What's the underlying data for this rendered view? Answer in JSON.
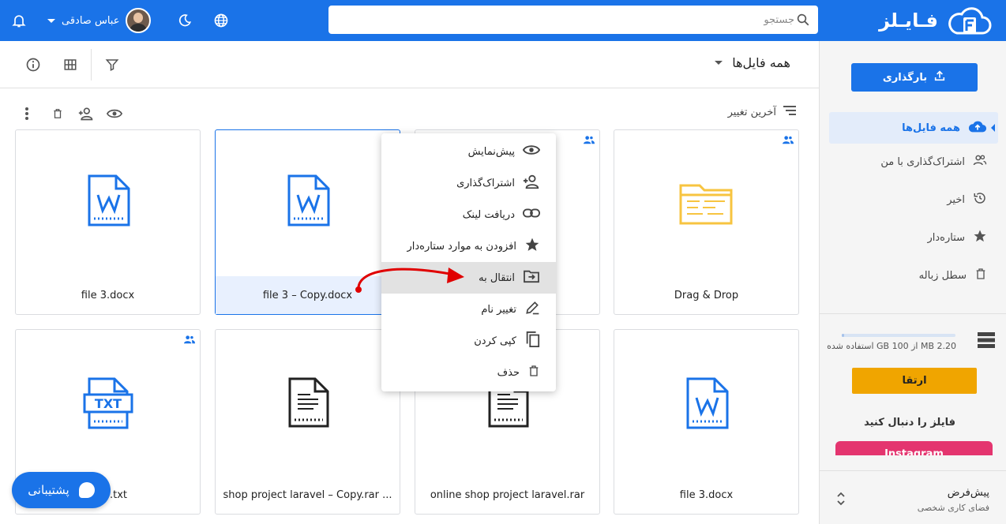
{
  "colors": {
    "primary": "#1a73e8",
    "upgrade": "#f0a500",
    "instagram": "#e4356f",
    "folder": "#f7c440"
  },
  "header": {
    "logo_text": "فـایـلز",
    "search_placeholder": "جستجو",
    "user_name": "عباس صادقی",
    "icons": [
      "search-icon",
      "globe-icon",
      "moon-icon",
      "bell-icon",
      "chevron-down-icon"
    ]
  },
  "sidebar": {
    "upload_label": "بارگذاری",
    "items": [
      {
        "label": "همه فایل‌ها",
        "icon": "cloud-upload-icon",
        "active": true
      },
      {
        "label": "اشتراک‌گذاری با من",
        "icon": "people-icon"
      },
      {
        "label": "اخیر",
        "icon": "history-icon"
      },
      {
        "label": "ستاره‌دار",
        "icon": "star-icon"
      },
      {
        "label": "سطل زباله",
        "icon": "trash-icon"
      }
    ],
    "storage_text": "2.20 MB از 100 GB استفاده شده",
    "storage_fraction": 0.0,
    "upgrade_label": "ارتقا",
    "follow_text": "فایلز را دنبال کنید",
    "instagram_label": "Instagram",
    "workspace_title": "پیش‌فرض",
    "workspace_subtitle": "فضای کاری شخصی"
  },
  "main": {
    "title": "همه فایل‌ها",
    "sort_label": "آخرین تغییر",
    "header_icons": [
      "filter-icon",
      "grid-icon",
      "info-icon"
    ],
    "action_icons": [
      "eye-icon",
      "person-add-icon",
      "trash-icon",
      "more-vert-icon"
    ]
  },
  "files": [
    {
      "name": "file 3.docx",
      "type": "word"
    },
    {
      "name": "file 3 – Copy.docx",
      "type": "word",
      "selected": true
    },
    {
      "name": "",
      "type": "hidden",
      "shared": true
    },
    {
      "name": "Drag & Drop",
      "type": "folder",
      "shared": true
    },
    {
      "name": ".txt",
      "type": "txt",
      "shared": true
    },
    {
      "name": "shop project laravel – Copy.rar ...",
      "type": "archive"
    },
    {
      "name": "online shop project laravel.rar",
      "type": "archive"
    },
    {
      "name": "file 3.docx",
      "type": "word"
    }
  ],
  "context_menu": [
    {
      "label": "پیش‌نمایش",
      "icon": "eye-icon"
    },
    {
      "label": "اشتراک‌گذاری",
      "icon": "person-add-icon"
    },
    {
      "label": "دریافت لینک",
      "icon": "link-icon"
    },
    {
      "label": "افزودن به موارد ستاره‌دار",
      "icon": "star-icon"
    },
    {
      "label": "انتقال به",
      "icon": "move-icon",
      "highlighted": true
    },
    {
      "label": "تغییر نام",
      "icon": "edit-icon"
    },
    {
      "label": "کپی کردن",
      "icon": "copy-icon"
    },
    {
      "label": "حذف",
      "icon": "trash-icon"
    }
  ],
  "support_label": "پشتیبانی"
}
